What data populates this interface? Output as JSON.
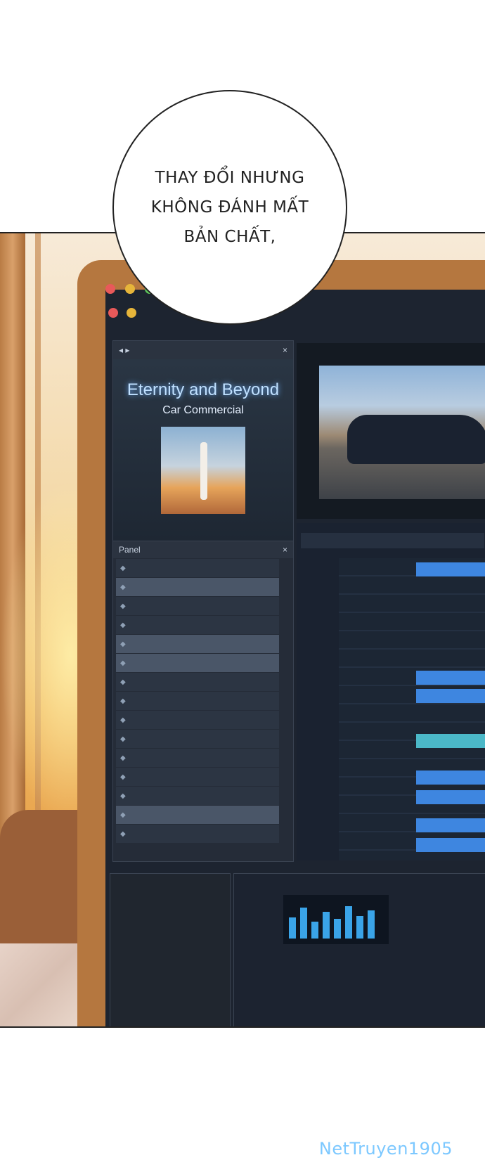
{
  "speech": {
    "line1": "THAY ĐỔI NHƯNG",
    "line2": "KHÔNG ĐÁNH MẤT",
    "line3": "BẢN CHẤT,"
  },
  "library": {
    "header_close": "×",
    "title": "Eternity and Beyond",
    "subtitle": "Car Commercial",
    "list_title": "Panel",
    "list_close": "×"
  },
  "watermark": "NetTruyen1905"
}
